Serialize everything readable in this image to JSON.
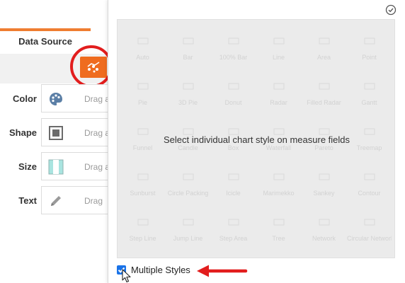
{
  "left_panel": {
    "tab": {
      "label": "Data Source"
    },
    "chart_type_button": {
      "icon": "chart-style-icon",
      "color": "#ef6c1f"
    },
    "fields": [
      {
        "label": "Color",
        "placeholder": "Drag a",
        "icon": "palette-icon"
      },
      {
        "label": "Shape",
        "placeholder": "Drag a",
        "icon": "square-icon"
      },
      {
        "label": "Size",
        "placeholder": "Drag a",
        "icon": "size-icon"
      },
      {
        "label": "Text",
        "placeholder": "Drag",
        "icon": "pencil-icon"
      }
    ]
  },
  "chart_style_panel": {
    "message": "Select individual chart style on measure fields",
    "multiple_styles": {
      "label": "Multiple Styles",
      "checked": true
    },
    "grid_labels": [
      [
        "Auto",
        "Bar",
        "100% Bar",
        "Line",
        "Area",
        "Point"
      ],
      [
        "Pie",
        "3D Pie",
        "Donut",
        "Radar",
        "Filled Radar",
        "Gantt"
      ],
      [
        "Funnel",
        "Candle",
        "Box",
        "Waterfall",
        "Pareto",
        "Treemap"
      ],
      [
        "Sunburst",
        "Circle Packing",
        "Icicle",
        "Marimekko",
        "Sankey",
        "Contour"
      ],
      [
        "Step Line",
        "Jump Line",
        "Step Area",
        "Tree",
        "Network",
        "Circular Network"
      ]
    ]
  },
  "colors": {
    "accent": "#ef7d31",
    "highlight": "#e21d1d",
    "checkbox": "#1a73e8"
  }
}
